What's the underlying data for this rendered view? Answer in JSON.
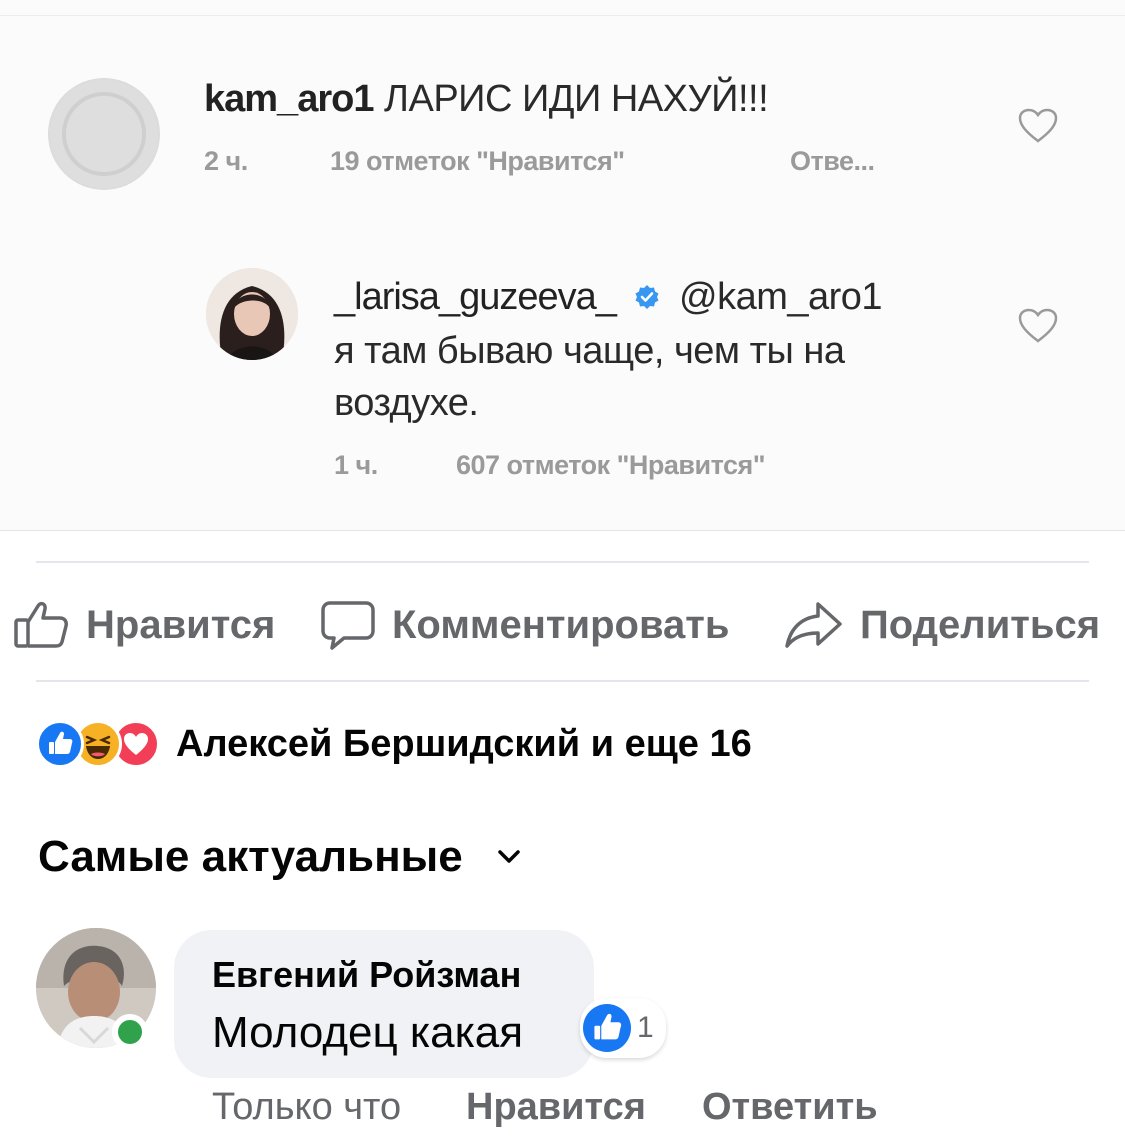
{
  "instagram": {
    "comment1": {
      "username": "kam_aro1",
      "text": "ЛАРИС ИДИ НАХУЙ!!!",
      "time": "2 ч.",
      "likes": "19 отметок \"Нравится\"",
      "reply": "Отве..."
    },
    "reply1": {
      "username": "_larisa_guzeeva_",
      "mention": "@kam_aro1",
      "text_line1": "я там бываю чаще, чем ты на",
      "text_line2": "воздухе.",
      "time": "1 ч.",
      "likes": "607 отметок \"Нравится\""
    }
  },
  "post_actions": {
    "like": "Нравится",
    "comment": "Комментировать",
    "share": "Поделиться"
  },
  "reactions": {
    "icons": [
      "like-icon",
      "haha-icon",
      "love-icon"
    ],
    "summary": "Алексей Бершидский и еще 16"
  },
  "comments": {
    "sort_label": "Самые актуальные",
    "items": [
      {
        "author": "Евгений Ройзман",
        "text": "Молодец какая",
        "like_count": "1",
        "time": "Только что",
        "like_action": "Нравится",
        "reply_action": "Ответить"
      }
    ]
  },
  "colors": {
    "facebook_blue": "#1877f2",
    "secondary_text": "#65676b",
    "online_green": "#31a24c",
    "bubble_bg": "#f0f2f5",
    "instagram_verified": "#3897f0"
  }
}
